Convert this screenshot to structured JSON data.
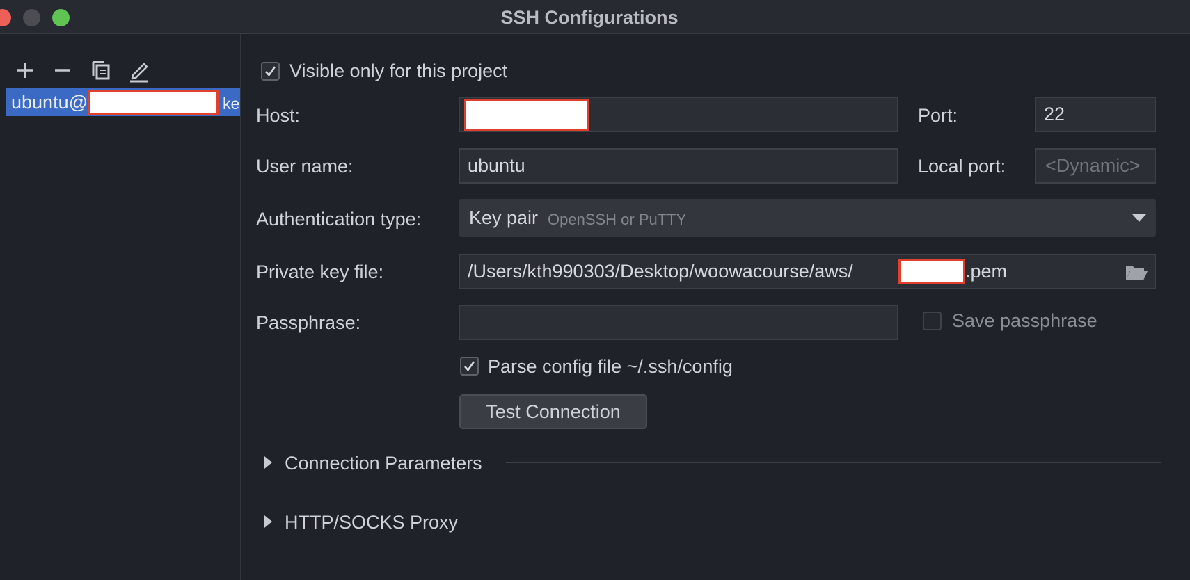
{
  "window": {
    "title": "SSH Configurations"
  },
  "toolbar": {
    "add_icon": "plus-icon",
    "remove_icon": "minus-icon",
    "copy_icon": "copy-icon",
    "edit_icon": "pencil-icon"
  },
  "sidebar": {
    "items": [
      {
        "user": "ubuntu@",
        "suffix": "ke"
      }
    ]
  },
  "form": {
    "visible_only_label": "Visible only for this project",
    "visible_only_checked": true,
    "host_label": "Host:",
    "host_value": "",
    "port_label": "Port:",
    "port_value": "22",
    "username_label": "User name:",
    "username_value": "ubuntu",
    "local_port_label": "Local port:",
    "local_port_placeholder": "<Dynamic>",
    "auth_type_label": "Authentication type:",
    "auth_type_value": "Key pair",
    "auth_type_hint": "OpenSSH or PuTTY",
    "private_key_label": "Private key file:",
    "private_key_prefix": "/Users/kth990303/Desktop/woowacourse/aws/",
    "private_key_suffix": ".pem",
    "passphrase_label": "Passphrase:",
    "passphrase_value": "",
    "save_passphrase_label": "Save passphrase",
    "save_passphrase_checked": false,
    "parse_config_label": "Parse config file ~/.ssh/config",
    "parse_config_checked": true,
    "test_connection_label": "Test Connection"
  },
  "sections": [
    {
      "label": "Connection Parameters"
    },
    {
      "label": "HTTP/SOCKS Proxy"
    }
  ],
  "colors": {
    "background": "#1f2228",
    "selection": "#3b6ac4",
    "redaction_border": "#e0402e"
  }
}
